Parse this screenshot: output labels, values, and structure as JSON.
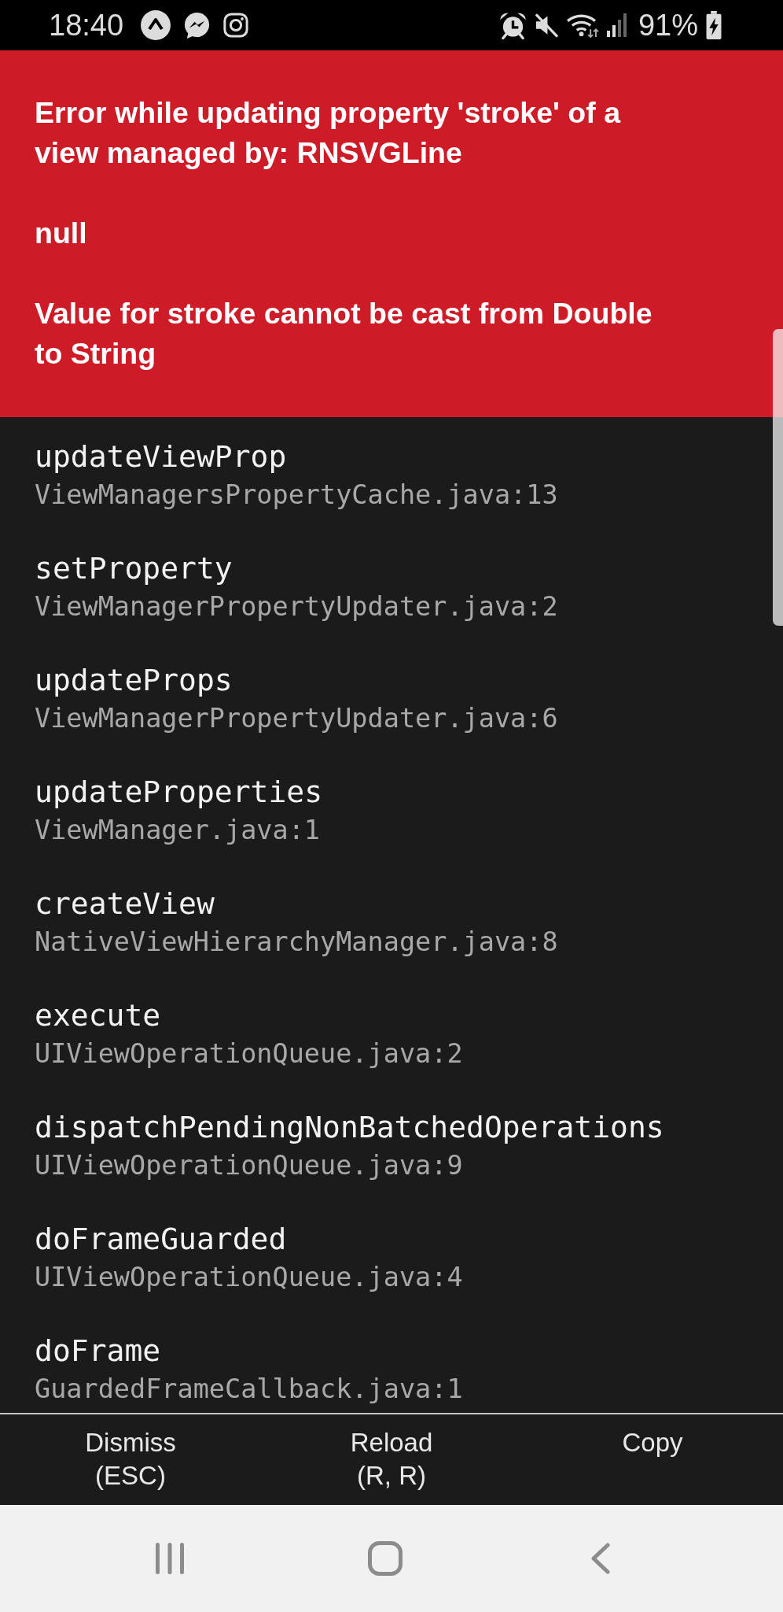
{
  "status_bar": {
    "time": "18:40",
    "battery": "91%"
  },
  "error": {
    "paragraphs": [
      "Error while updating property 'stroke' of a view managed by: RNSVGLine",
      "null",
      "Value for stroke cannot be cast from Double to String"
    ]
  },
  "stack": [
    {
      "method": "updateViewProp",
      "file": "ViewManagersPropertyCache.java:13"
    },
    {
      "method": "setProperty",
      "file": "ViewManagerPropertyUpdater.java:2"
    },
    {
      "method": "updateProps",
      "file": "ViewManagerPropertyUpdater.java:6"
    },
    {
      "method": "updateProperties",
      "file": "ViewManager.java:1"
    },
    {
      "method": "createView",
      "file": "NativeViewHierarchyManager.java:8"
    },
    {
      "method": "execute",
      "file": "UIViewOperationQueue.java:2"
    },
    {
      "method": "dispatchPendingNonBatchedOperations",
      "file": "UIViewOperationQueue.java:9"
    },
    {
      "method": "doFrameGuarded",
      "file": "UIViewOperationQueue.java:4"
    },
    {
      "method": "doFrame",
      "file": "GuardedFrameCallback.java:1"
    }
  ],
  "buttons": [
    {
      "label": "Dismiss",
      "shortcut": "(ESC)"
    },
    {
      "label": "Reload",
      "shortcut": "(R, R)"
    },
    {
      "label": "Copy"
    }
  ]
}
